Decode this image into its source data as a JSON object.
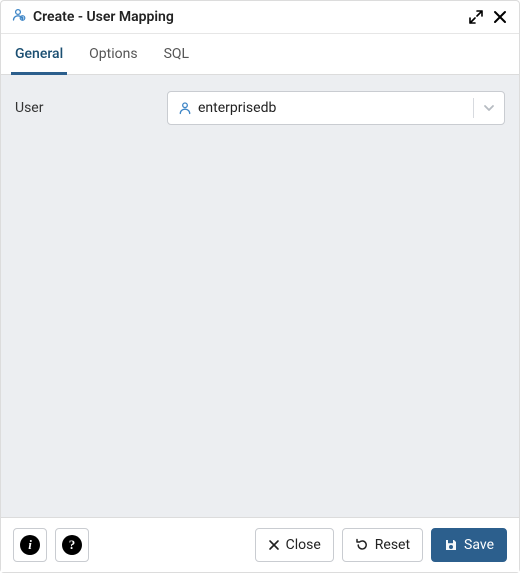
{
  "header": {
    "title": "Create - User Mapping"
  },
  "tabs": [
    {
      "label": "General",
      "active": true
    },
    {
      "label": "Options",
      "active": false
    },
    {
      "label": "SQL",
      "active": false
    }
  ],
  "form": {
    "user_label": "User",
    "user_value": "enterprisedb"
  },
  "footer": {
    "close_label": "Close",
    "reset_label": "Reset",
    "save_label": "Save"
  }
}
